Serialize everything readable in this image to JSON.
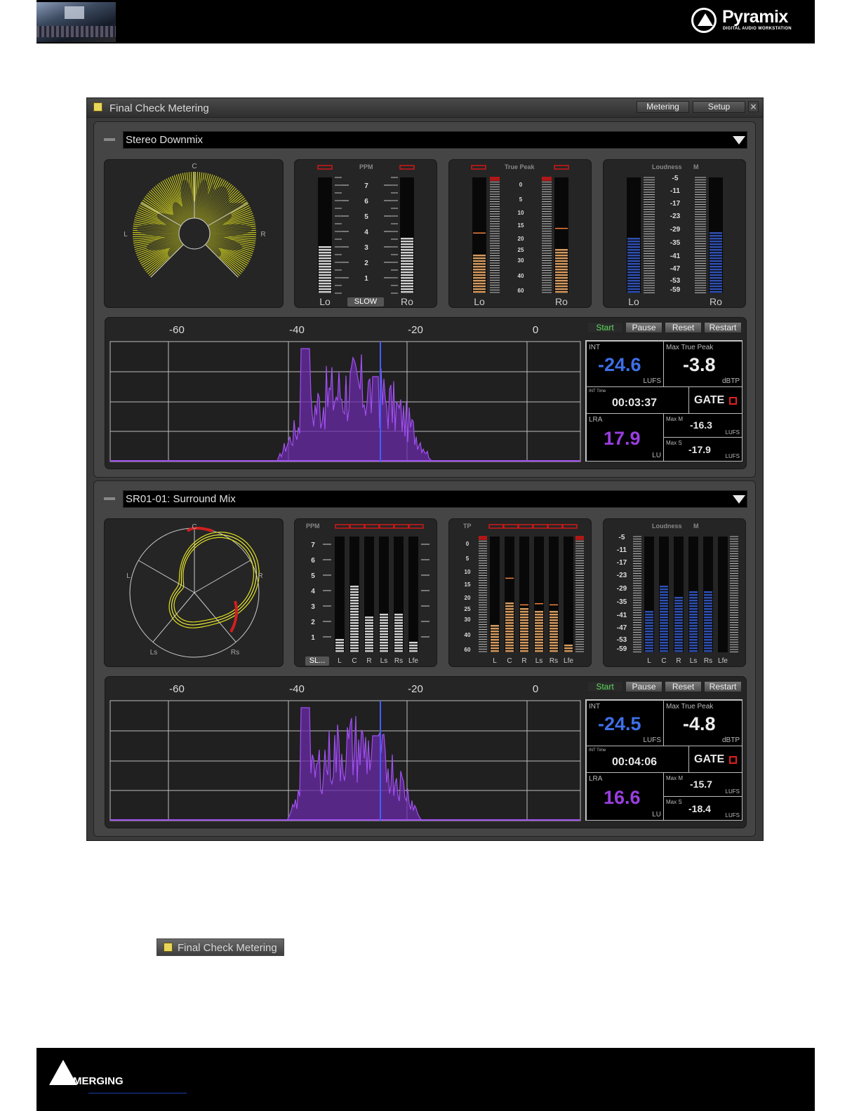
{
  "header": {
    "brand": "Pyramix",
    "brand_sub": "DIGITAL AUDIO WORKSTATION"
  },
  "footer": {
    "brand": "MERGING"
  },
  "window": {
    "title": "Final Check Metering",
    "tabs": [
      "Metering",
      "Setup"
    ],
    "close": "×"
  },
  "colors": {
    "purple": "#9a3ee0",
    "int_blue": "#3e6fe8",
    "vector_yellow": "#e0e020",
    "true_peak": "#d49a60",
    "loudness_bar": "#2f4fb0",
    "ppm_bar": "#d0d0d0"
  },
  "sections": [
    {
      "minimize": "—",
      "source": "Stereo Downmix",
      "vector": {
        "labels": {
          "c": "C",
          "l": "L",
          "r": "R"
        }
      },
      "ppm": {
        "title": "PPM",
        "scale": [
          "7",
          "6",
          "5",
          "4",
          "3",
          "2",
          "1"
        ],
        "channels": [
          "Lo",
          "Ro"
        ],
        "levels": [
          0.42,
          0.48
        ],
        "button": "SLOW"
      },
      "true_peak": {
        "title": "True Peak",
        "scale": [
          "0",
          "5",
          "10",
          "15",
          "20",
          "25",
          "30",
          "40",
          "60"
        ],
        "channels": [
          "Lo",
          "Ro"
        ],
        "levels": [
          0.35,
          0.4
        ],
        "holds": [
          0.52,
          0.56
        ]
      },
      "loudness": {
        "title": "Loudness",
        "mode": "M",
        "scale": [
          "-5",
          "-11",
          "-17",
          "-23",
          "-29",
          "-35",
          "-41",
          "-47",
          "-53",
          "-59"
        ],
        "channels": [
          "Lo",
          "Ro"
        ],
        "levels": [
          0.5,
          0.54
        ]
      },
      "histogram": {
        "scale": [
          "-60",
          "-40",
          "-20",
          "0"
        ],
        "buttons": [
          "Start",
          "Pause",
          "Reset",
          "Restart"
        ]
      },
      "readout": {
        "int_label": "INT",
        "int_value": "-24.6",
        "int_unit": "LUFS",
        "mtp_label": "Max True Peak",
        "mtp_value": "-3.8",
        "mtp_unit": "dBTP",
        "time_label": "INT Time",
        "time_value": "00:03:37",
        "gate": "GATE",
        "lra_label": "LRA",
        "lra_value": "17.9",
        "lra_unit": "LU",
        "maxm_label": "Max M",
        "maxm_value": "-16.3",
        "maxm_unit": "LUFS",
        "maxs_label": "Max S",
        "maxs_value": "-17.9",
        "maxs_unit": "LUFS"
      }
    },
    {
      "minimize": "—",
      "source": "SR01-01: Surround Mix",
      "vector": {
        "labels": {
          "c": "C",
          "l": "L",
          "r": "R",
          "ls": "Ls",
          "rs": "Rs"
        }
      },
      "ppm": {
        "title": "PPM",
        "scale": [
          "7",
          "6",
          "5",
          "4",
          "3",
          "2",
          "1"
        ],
        "channels": [
          "L",
          "C",
          "R",
          "Ls",
          "Rs",
          "Lfe"
        ],
        "levels": [
          0.12,
          0.6,
          0.32,
          0.35,
          0.35,
          0.1
        ],
        "button": "SL..."
      },
      "true_peak": {
        "title": "TP",
        "scale": [
          "0",
          "5",
          "10",
          "15",
          "20",
          "25",
          "30",
          "40",
          "60"
        ],
        "channels": [
          "L",
          "C",
          "R",
          "Ls",
          "Rs",
          "Lfe"
        ],
        "levels": [
          0.26,
          0.44,
          0.4,
          0.36,
          0.36,
          0.07
        ],
        "holds": [
          0,
          0.64,
          0.41,
          0.42,
          0.41,
          0
        ]
      },
      "loudness": {
        "title": "Loudness",
        "mode": "M",
        "scale": [
          "-5",
          "-11",
          "-17",
          "-23",
          "-29",
          "-35",
          "-41",
          "-47",
          "-53",
          "-59"
        ],
        "channels": [
          "L",
          "C",
          "R",
          "Ls",
          "Rs",
          "Lfe"
        ],
        "levels": [
          0.38,
          0.58,
          0.48,
          0.53,
          0.53,
          0
        ]
      },
      "histogram": {
        "scale": [
          "-60",
          "-40",
          "-20",
          "0"
        ],
        "buttons": [
          "Start",
          "Pause",
          "Reset",
          "Restart"
        ]
      },
      "readout": {
        "int_label": "INT",
        "int_value": "-24.5",
        "int_unit": "LUFS",
        "mtp_label": "Max True Peak",
        "mtp_value": "-4.8",
        "mtp_unit": "dBTP",
        "time_label": "INT Time",
        "time_value": "00:04:06",
        "gate": "GATE",
        "lra_label": "LRA",
        "lra_value": "16.6",
        "lra_unit": "LU",
        "maxm_label": "Max M",
        "maxm_value": "-15.7",
        "maxm_unit": "LUFS",
        "maxs_label": "Max S",
        "maxs_value": "-18.4",
        "maxs_unit": "LUFS"
      }
    }
  ],
  "chip": {
    "title": "Final Check Metering"
  }
}
